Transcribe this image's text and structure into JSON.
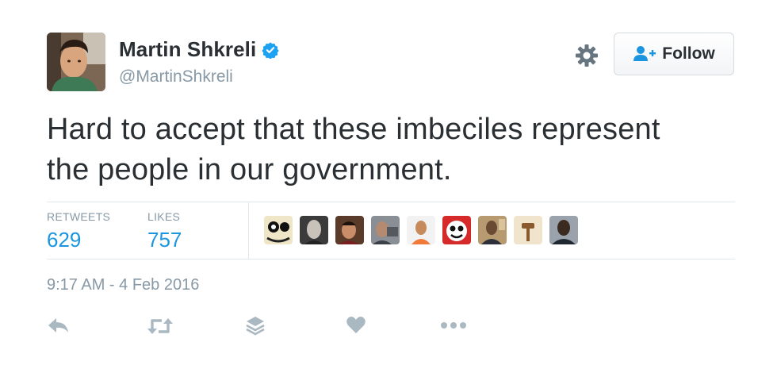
{
  "user": {
    "name": "Martin Shkreli",
    "handle": "@MartinShkreli",
    "verified": true
  },
  "follow_button": {
    "label": "Follow"
  },
  "tweet": {
    "text_line1": "Hard to accept that these imbeciles represent",
    "text_line2": "the people in our government."
  },
  "stats": {
    "retweets_label": "RETWEETS",
    "retweets_value": "629",
    "likes_label": "LIKES",
    "likes_value": "757"
  },
  "timestamp": "9:17 AM - 4 Feb 2016",
  "colors": {
    "accent": "#1b95e0",
    "verified": "#1da1f2",
    "muted": "#8899a6",
    "text": "#292f33"
  },
  "icons": {
    "settings": "gear-icon",
    "follow": "add-user-icon",
    "reply": "reply-icon",
    "retweet": "retweet-icon",
    "moments": "layers-icon",
    "like": "heart-icon",
    "more": "more-icon"
  }
}
